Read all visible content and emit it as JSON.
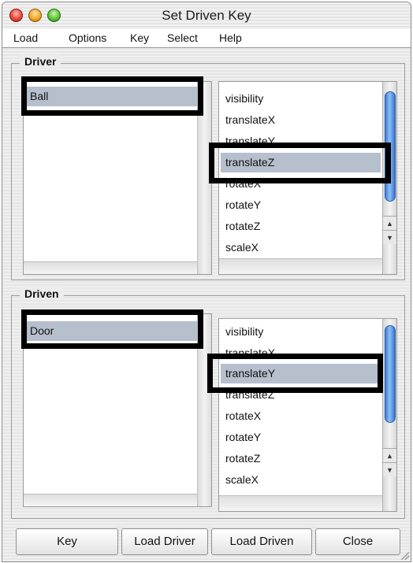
{
  "window": {
    "title": "Set Driven Key"
  },
  "menu": [
    "Load",
    "Options",
    "Key",
    "Select",
    "Help"
  ],
  "driver": {
    "label": "Driver",
    "objects": [
      {
        "name": "Ball",
        "selected": true
      }
    ],
    "attributes": [
      {
        "name": "visibility",
        "selected": false
      },
      {
        "name": "translateX",
        "selected": false
      },
      {
        "name": "translateY",
        "selected": false
      },
      {
        "name": "translateZ",
        "selected": true
      },
      {
        "name": "rotateX",
        "selected": false
      },
      {
        "name": "rotateY",
        "selected": false
      },
      {
        "name": "rotateZ",
        "selected": false
      },
      {
        "name": "scaleX",
        "selected": false
      }
    ]
  },
  "driven": {
    "label": "Driven",
    "objects": [
      {
        "name": "Door",
        "selected": true
      }
    ],
    "attributes": [
      {
        "name": "visibility",
        "selected": false
      },
      {
        "name": "translateX",
        "selected": false
      },
      {
        "name": "translateY",
        "selected": true
      },
      {
        "name": "translateZ",
        "selected": false
      },
      {
        "name": "rotateX",
        "selected": false
      },
      {
        "name": "rotateY",
        "selected": false
      },
      {
        "name": "rotateZ",
        "selected": false
      },
      {
        "name": "scaleX",
        "selected": false
      }
    ]
  },
  "buttons": [
    "Key",
    "Load Driver",
    "Load Driven",
    "Close"
  ],
  "colors": {
    "selection": "#b6bfcc",
    "highlight_box": "#000000",
    "scroll_thumb": "#4a8ce0"
  }
}
